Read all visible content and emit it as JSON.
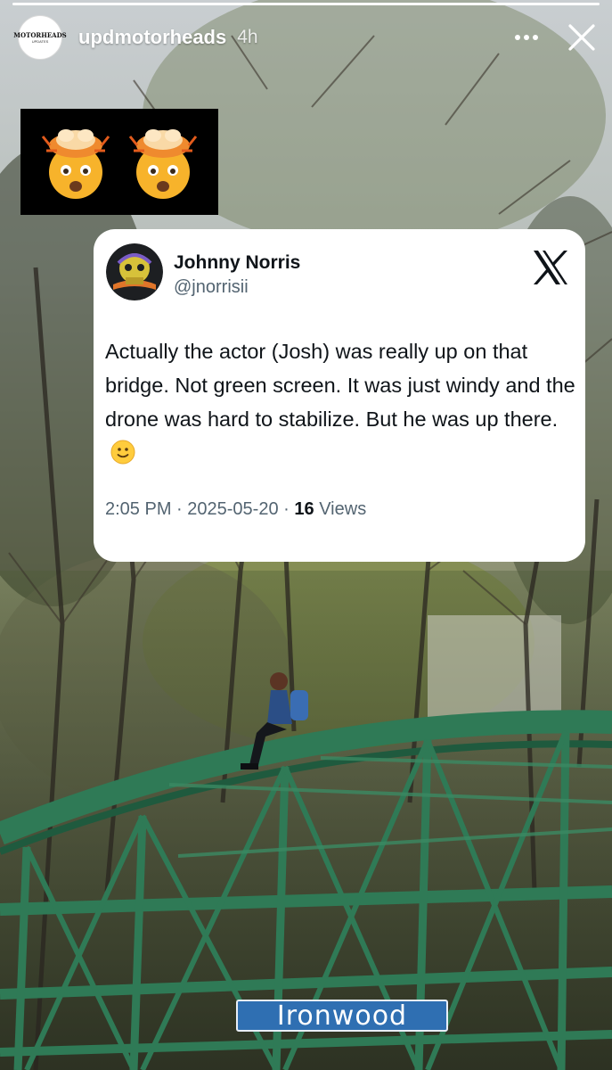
{
  "story": {
    "username": "updmotorheads",
    "time_ago": "4h",
    "progress": 1.0,
    "avatar": {
      "brand": "MOTORHEADS",
      "brand_sub": "UPDATES"
    },
    "more_icon": "more-horizontal-icon",
    "close_icon": "close-icon"
  },
  "sticker": {
    "emojis": [
      "exploding-head-emoji",
      "exploding-head-emoji"
    ],
    "background": "#000000"
  },
  "tweet": {
    "display_name": "Johnny Norris",
    "handle": "@jnorrisii",
    "text": "Actually the actor (Josh) was really up on that bridge. Not green screen. It was just windy and the drone was hard to stabilize. But he was up there.",
    "emoji": "slightly-smiling-face-emoji",
    "time": "2:05 PM",
    "date": "2025-05-20",
    "views_count": "16",
    "views_label": "Views",
    "separator": "·",
    "platform_icon": "x-logo-icon"
  },
  "photo": {
    "sign_text": "Ironwood"
  },
  "colors": {
    "bridge_green": "#2f7a56",
    "card_bg": "#ffffff",
    "meta_gray": "#536471",
    "text_dark": "#0f1419"
  }
}
